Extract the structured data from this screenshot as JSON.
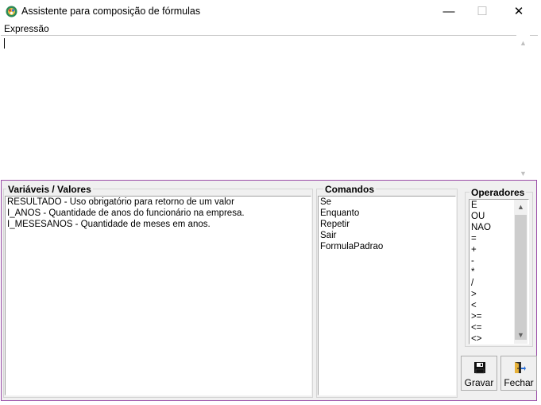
{
  "window": {
    "title": "Assistente para composição de fórmulas",
    "minimize_glyph": "—",
    "maximize_glyph": "☐",
    "close_glyph": "✕"
  },
  "expression": {
    "label": "Expressão",
    "value": ""
  },
  "variables": {
    "title": "Variáveis / Valores",
    "items": [
      "RESULTADO - Uso obrigatório para retorno de um valor",
      "I_ANOS - Quantidade de anos do funcionário na empresa.",
      "I_MESESANOS - Quantidade de meses em anos."
    ]
  },
  "commands": {
    "title": "Comandos",
    "items": [
      "Se",
      "Enquanto",
      "Repetir",
      "Sair",
      "FormulaPadrao"
    ]
  },
  "operators": {
    "title": "Operadores",
    "items": [
      "E",
      "OU",
      "NAO",
      "=",
      "+",
      "-",
      "*",
      "/",
      ">",
      "<",
      ">=",
      "<=",
      "<>"
    ]
  },
  "buttons": {
    "save": "Gravar",
    "exit": "Fechar"
  },
  "icons": {
    "app": "app-icon",
    "save": "floppy-disk-icon",
    "exit": "door-exit-icon"
  },
  "colors": {
    "panel_border": "#9b4fa8",
    "panel_bg": "#f0f0f0"
  }
}
